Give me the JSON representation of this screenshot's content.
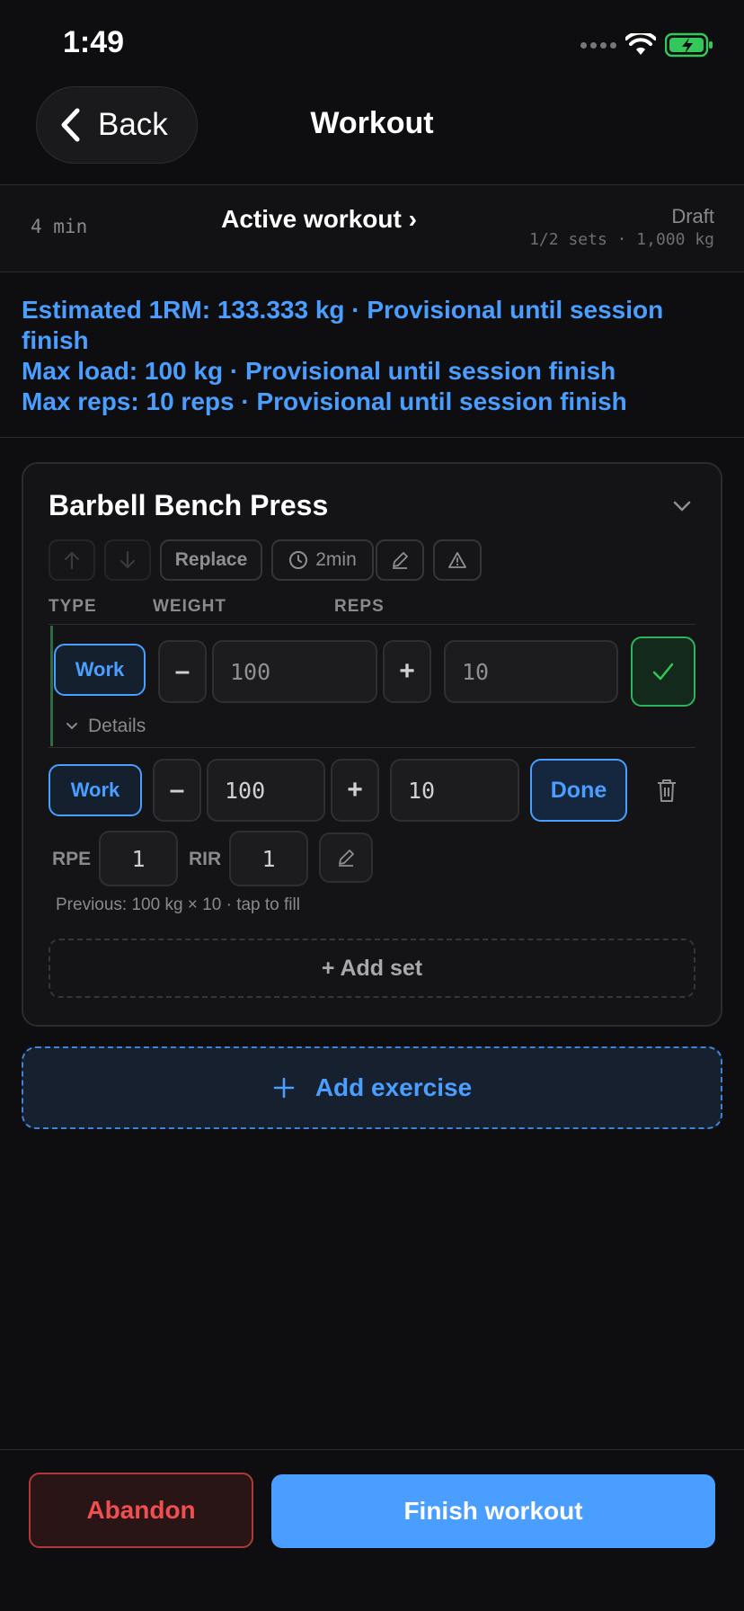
{
  "status_bar": {
    "time": "1:49"
  },
  "nav": {
    "back_label": "Back",
    "title": "Workout"
  },
  "summary": {
    "elapsed": "4 min",
    "active_link": "Active workout ›",
    "state": "Draft",
    "sets_summary": "1/2 sets · 1,000 kg"
  },
  "pr_notes": [
    "Estimated 1RM: 133.333 kg · Provisional until session finish",
    "Max load: 100 kg · Provisional until session finish",
    "Max reps: 10 reps · Provisional until session finish"
  ],
  "exercise": {
    "name": "Barbell Bench Press",
    "toolbar": {
      "replace_label": "Replace",
      "rest_label": "2min"
    },
    "columns": {
      "type": "TYPE",
      "weight": "WEIGHT",
      "reps": "REPS"
    },
    "sets": [
      {
        "type": "Work",
        "weight": "100",
        "reps": "10",
        "completed": true,
        "details_label": "Details"
      },
      {
        "type": "Work",
        "weight": "100",
        "reps": "10",
        "completed": false,
        "done_label": "Done",
        "rpe_label": "RPE",
        "rpe": "1",
        "rir_label": "RIR",
        "rir": "1",
        "previous_hint": "Previous: 100 kg × 10 · tap to fill"
      }
    ],
    "add_set_label": "+ Add set"
  },
  "add_exercise_label": "Add exercise",
  "footer": {
    "abandon_label": "Abandon",
    "finish_label": "Finish workout"
  },
  "colors": {
    "accent": "#4a9eff",
    "success": "#2fb35f",
    "danger": "#ef4f4f",
    "background": "#0e0e10"
  }
}
